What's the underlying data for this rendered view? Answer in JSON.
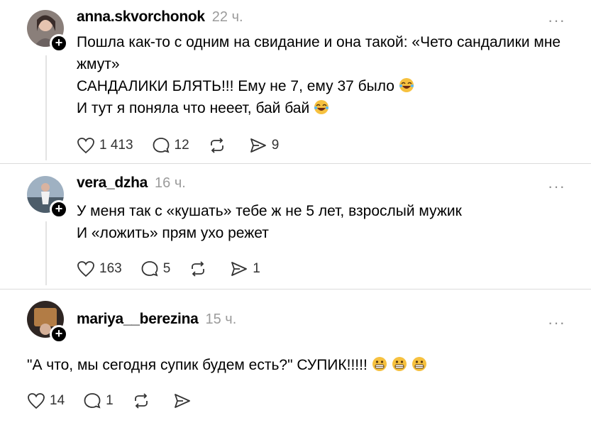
{
  "posts": [
    {
      "username": "anna.skvorchonok",
      "time": "22 ч.",
      "more": "···",
      "lines": [
        "Пошла как-то с одним на свидание и она такой: «Чето сандалики мне жмут»",
        "САНДАЛИКИ БЛЯТЬ!!! Ему не 7, ему 37 было",
        "И тут я поняла что нееет, бай бай"
      ],
      "likes": "1 413",
      "comments": "12",
      "reposts": "",
      "shares": "9"
    },
    {
      "username": "vera_dzha",
      "time": "16 ч.",
      "more": "···",
      "lines": [
        "У меня так с «кушать» тебе ж не 5 лет, взрослый мужик",
        "И «ложить» прям ухо режет"
      ],
      "likes": "163",
      "comments": "5",
      "reposts": "",
      "shares": "1"
    },
    {
      "username": "mariya__berezina",
      "time": "15 ч.",
      "more": "···",
      "lines": [
        "\"А что, мы сегодня супик будем есть?\" СУПИК!!!!!"
      ],
      "likes": "14",
      "comments": "1",
      "reposts": "",
      "shares": ""
    }
  ],
  "icons": {
    "like": "heart-icon",
    "comment": "comment-icon",
    "repost": "repost-icon",
    "share": "share-icon",
    "laugh": "tears-of-joy-emoji",
    "grimace": "grimacing-emoji"
  },
  "colors": {
    "text": "#000000",
    "muted": "#9b9b9b",
    "divider": "#dcdcdc",
    "emoji": "#f6c13f"
  }
}
